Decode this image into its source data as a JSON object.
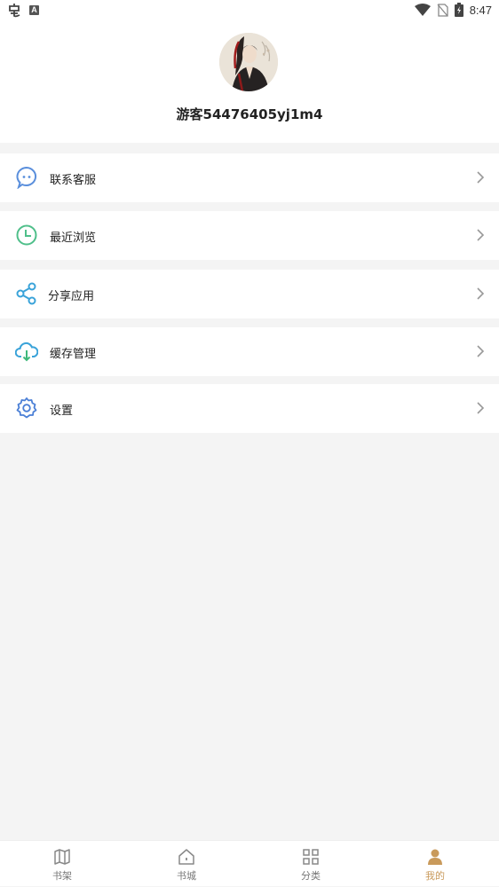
{
  "status_bar": {
    "time": "8:47",
    "badge": "A"
  },
  "profile": {
    "username": "游客54476405yj1m4"
  },
  "menu": [
    {
      "label": "联系客服",
      "icon": "chat-bubble-icon",
      "color": "#5a8fdc"
    },
    {
      "label": "最近浏览",
      "icon": "clock-icon",
      "color": "#4fbf8a"
    },
    {
      "label": "分享应用",
      "icon": "share-icon",
      "color": "#3aa3d9"
    },
    {
      "label": "缓存管理",
      "icon": "cloud-download-icon",
      "color": "#3aa3d9"
    },
    {
      "label": "设置",
      "icon": "gear-icon",
      "color": "#4a7fd6"
    }
  ],
  "bottom_nav": [
    {
      "label": "书架",
      "icon": "bookshelf-icon"
    },
    {
      "label": "书城",
      "icon": "home-icon"
    },
    {
      "label": "分类",
      "icon": "category-grid-icon"
    },
    {
      "label": "我的",
      "icon": "user-icon",
      "active": true
    }
  ],
  "colors": {
    "accent": "#c99a5b",
    "background": "#f4f4f4"
  }
}
